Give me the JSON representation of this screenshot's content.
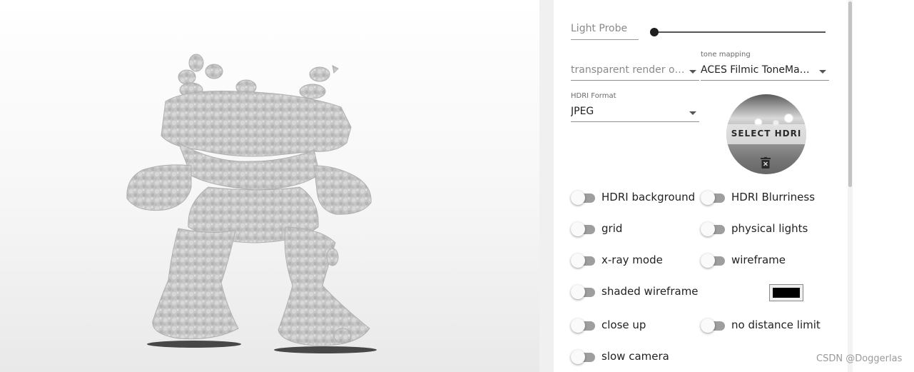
{
  "viewport": {
    "model": "voxel-robot-figure"
  },
  "panel": {
    "light_probe": {
      "label": "Light Probe",
      "value": 0
    },
    "render_order": {
      "value": "transparent render or…"
    },
    "tone_mapping": {
      "caption": "tone mapping",
      "value": "ACES Filmic ToneMa…"
    },
    "hdri_format": {
      "caption": "HDRI Format",
      "value": "JPEG"
    },
    "hdri_button": {
      "label": "SELECT HDRI",
      "delete_icon": "trash-icon"
    },
    "toggles": [
      {
        "label": "HDRI background",
        "on": false
      },
      {
        "label": "HDRI Blurriness",
        "on": false
      },
      {
        "label": "grid",
        "on": false
      },
      {
        "label": "physical lights",
        "on": false
      },
      {
        "label": "x-ray mode",
        "on": false
      },
      {
        "label": "wireframe",
        "on": false
      },
      {
        "label": "shaded wireframe",
        "on": false
      },
      {
        "label": "close up",
        "on": false
      },
      {
        "label": "no distance limit",
        "on": false
      },
      {
        "label": "slow camera",
        "on": false
      }
    ],
    "wireframe_color": "#000000"
  },
  "watermark": "CSDN @Doggerlas"
}
